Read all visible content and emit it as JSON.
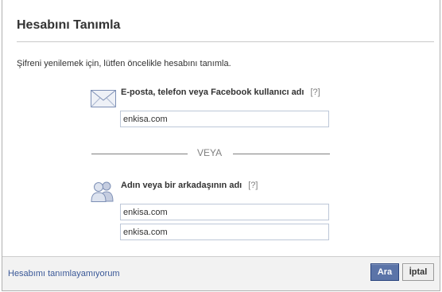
{
  "dialog": {
    "title": "Hesabını Tanımla",
    "instruction": "Şifreni yenilemek için, lütfen öncelikle hesabını tanımla."
  },
  "email_section": {
    "icon": "envelope-icon",
    "label": "E-posta, telefon veya Facebook kullanıcı adı",
    "help": "[?]",
    "value": "enkisa.com"
  },
  "divider": {
    "text": "VEYA"
  },
  "name_section": {
    "icon": "people-icon",
    "label": "Adın veya bir arkadaşının adı",
    "help": "[?]",
    "name_value": "enkisa.com",
    "friend_value": "enkisa.com"
  },
  "footer": {
    "link": "Hesabımı tanımlayamıyorum",
    "search_label": "Ara",
    "cancel_label": "İptal"
  },
  "colors": {
    "primary_button": "#5b74a8",
    "link": "#3b5998",
    "input_border": "#bdc7d8"
  }
}
